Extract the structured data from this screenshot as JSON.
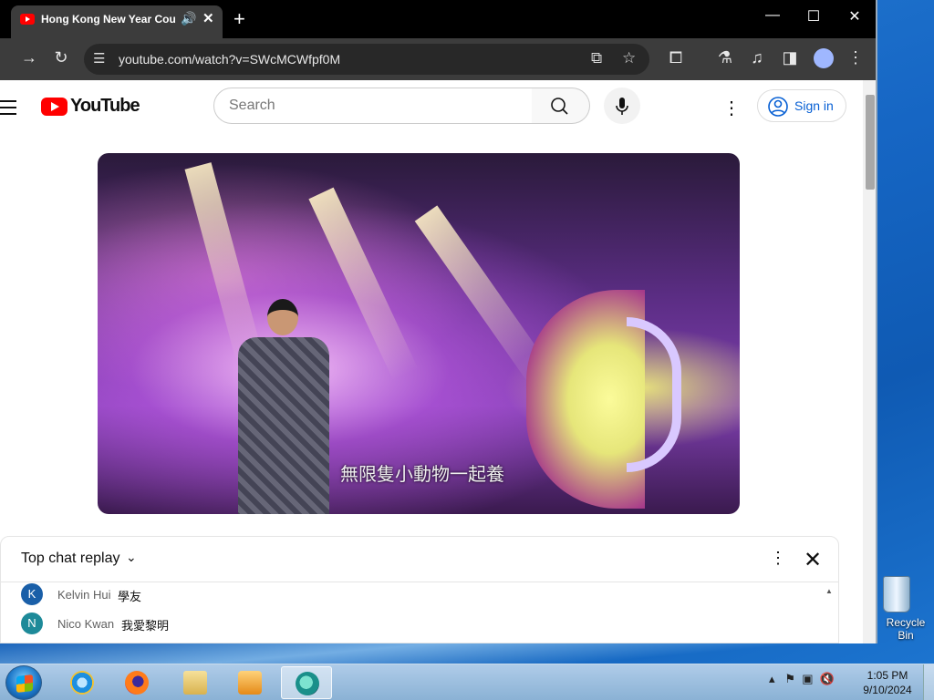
{
  "browser": {
    "tab_title": "Hong Kong New Year Countdown",
    "tab_close": "✕",
    "new_tab": "+",
    "url": "youtube.com/watch?v=SWcMCWfpf0M",
    "window_controls": {
      "minimize": "—",
      "maximize": "☐",
      "close": "✕"
    }
  },
  "youtube": {
    "logo_text": "YouTube",
    "search_placeholder": "Search",
    "signin_label": "Sign in",
    "video_subtitle": "無限隻小動物一起養"
  },
  "chat": {
    "title": "Top chat replay",
    "messages": [
      {
        "initial": "K",
        "name": "Kelvin Hui",
        "text": "學友",
        "color": "#1a5fa8"
      },
      {
        "initial": "N",
        "name": "Nico Kwan",
        "text": "我愛黎明",
        "color": "#1d8a99"
      }
    ]
  },
  "desktop": {
    "recycle_bin_label": "Recycle Bin"
  },
  "taskbar": {
    "apps": [
      "internet-explorer",
      "firefox",
      "file-explorer",
      "media-player",
      "active-app"
    ],
    "clock_time": "1:05 PM",
    "clock_date": "9/10/2024"
  },
  "colors": {
    "youtube_red": "#ff0000",
    "signin_blue": "#065fd4",
    "browser_frame": "#3c3c3c"
  }
}
